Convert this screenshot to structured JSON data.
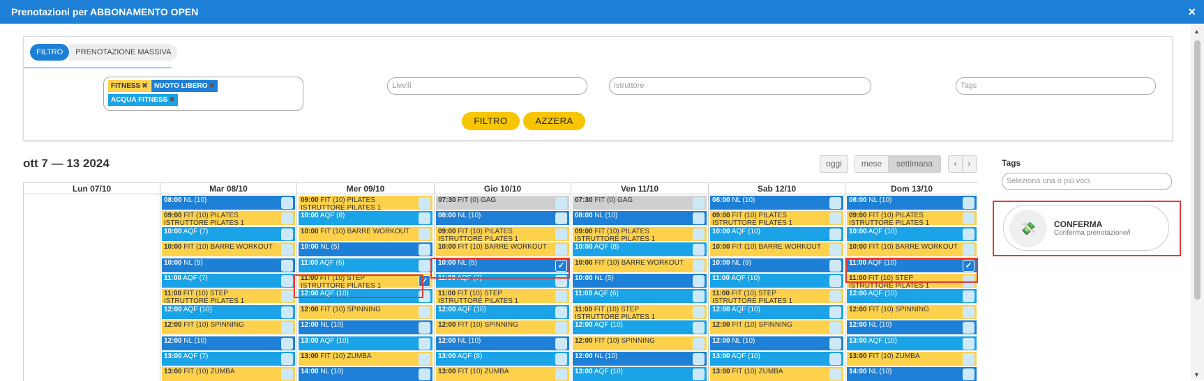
{
  "window": {
    "title": "Prenotazioni per ABBONAMENTO OPEN",
    "close": "×"
  },
  "filter": {
    "tab_active": "FILTRO",
    "tab_inactive": "PRENOTAZIONE MASSIVA",
    "chips": [
      "FITNESS",
      "NUOTO LIBERO",
      "ACQUA FITNESS"
    ],
    "livelli_placeholder": "Livelli",
    "istruttore_placeholder": "Istruttore",
    "tags_placeholder": "Tags",
    "btn_filtro": "FILTRO",
    "btn_azzera": "AZZERA"
  },
  "calendar": {
    "title": "ott 7 — 13 2024",
    "btn_oggi": "oggi",
    "btn_mese": "mese",
    "btn_settimana": "settimana",
    "btn_prev": "‹",
    "btn_next": "›",
    "days": [
      "Lun 07/10",
      "Mar 08/10",
      "Mer 09/10",
      "Gio 10/10",
      "Ven 11/10",
      "Sab 12/10",
      "Dom 13/10"
    ]
  },
  "events": [
    [],
    [
      {
        "t": "08:00",
        "txt": "NL (10)",
        "k": "nl"
      },
      {
        "t": "09:00",
        "txt": "FIT (10) PILATES",
        "sub": "ISTRUTTORE PILATES 1",
        "k": "fit"
      },
      {
        "t": "10:00",
        "txt": "AQF (7)",
        "k": "aqf"
      },
      {
        "t": "10:00",
        "txt": "FIT (10) BARRE WORKOUT",
        "k": "fit"
      },
      {
        "t": "10:00",
        "txt": "NL (5)",
        "k": "nl"
      },
      {
        "t": "11:00",
        "txt": "AQF (7)",
        "k": "aqf"
      },
      {
        "t": "11:00",
        "txt": "FIT (10) STEP",
        "sub": "ISTRUTTORE PILATES 1",
        "k": "fit"
      },
      {
        "t": "12:00",
        "txt": "AQF (10)",
        "k": "aqf"
      },
      {
        "t": "12:00",
        "txt": "FIT (10) SPINNING",
        "k": "fit"
      },
      {
        "t": "12:00",
        "txt": "NL (10)",
        "k": "nl"
      },
      {
        "t": "13:00",
        "txt": "AQF (7)",
        "k": "aqf"
      },
      {
        "t": "13:00",
        "txt": "FIT (10) ZUMBA",
        "k": "fit"
      }
    ],
    [
      {
        "t": "09:00",
        "txt": "FIT (10) PILATES",
        "sub": "ISTRUTTORE PILATES 1",
        "k": "fit"
      },
      {
        "t": "10:00",
        "txt": "AQF (8)",
        "k": "aqf"
      },
      {
        "t": "10:00",
        "txt": "FIT (10) BARRE WORKOUT",
        "k": "fit"
      },
      {
        "t": "10:00",
        "txt": "NL (5)",
        "k": "nl"
      },
      {
        "t": "11:00",
        "txt": "AQF (6)",
        "k": "aqf"
      },
      {
        "t": "11:00",
        "txt": "FIT (10) STEP",
        "sub": "ISTRUTTORE PILATES 1",
        "k": "fit",
        "checked": true
      },
      {
        "t": "12:00",
        "txt": "AQF (10)",
        "k": "aqf"
      },
      {
        "t": "12:00",
        "txt": "FIT (10) SPINNING",
        "k": "fit"
      },
      {
        "t": "12:00",
        "txt": "NL (10)",
        "k": "nl"
      },
      {
        "t": "13:00",
        "txt": "AQF (10)",
        "k": "aqf"
      },
      {
        "t": "13:00",
        "txt": "FIT (10) ZUMBA",
        "k": "fit"
      },
      {
        "t": "14:00",
        "txt": "NL (10)",
        "k": "nl"
      }
    ],
    [
      {
        "t": "07:30",
        "txt": "FIT (0) GAG",
        "k": "gag"
      },
      {
        "t": "08:00",
        "txt": "NL (10)",
        "k": "nl"
      },
      {
        "t": "09:00",
        "txt": "FIT (10) PILATES",
        "sub": "ISTRUTTORE PILATES 1",
        "k": "fit"
      },
      {
        "t": "10:00",
        "txt": "FIT (10) BARRE WORKOUT",
        "k": "fit"
      },
      {
        "t": "10:00",
        "txt": "NL (5)",
        "k": "nl",
        "checked": true
      },
      {
        "t": "11:00",
        "txt": "AQF (7)",
        "k": "aqf"
      },
      {
        "t": "11:00",
        "txt": "FIT (10) STEP",
        "sub": "ISTRUTTORE PILATES 1",
        "k": "fit"
      },
      {
        "t": "12:00",
        "txt": "AQF (10)",
        "k": "aqf"
      },
      {
        "t": "12:00",
        "txt": "FIT (10) SPINNING",
        "k": "fit"
      },
      {
        "t": "12:00",
        "txt": "NL (10)",
        "k": "nl"
      },
      {
        "t": "13:00",
        "txt": "AQF (8)",
        "k": "aqf"
      },
      {
        "t": "13:00",
        "txt": "FIT (10) ZUMBA",
        "k": "fit"
      }
    ],
    [
      {
        "t": "07:30",
        "txt": "FIT (0) GAG",
        "k": "gag"
      },
      {
        "t": "08:00",
        "txt": "NL (10)",
        "k": "nl"
      },
      {
        "t": "09:00",
        "txt": "FIT (10) PILATES",
        "sub": "ISTRUTTORE PILATES 1",
        "k": "fit"
      },
      {
        "t": "10:00",
        "txt": "AQF (8)",
        "k": "aqf"
      },
      {
        "t": "10:00",
        "txt": "FIT (10) BARRE WORKOUT",
        "k": "fit"
      },
      {
        "t": "10:00",
        "txt": "NL (5)",
        "k": "nl"
      },
      {
        "t": "11:00",
        "txt": "AQF (6)",
        "k": "aqf"
      },
      {
        "t": "11:00",
        "txt": "FIT (10) STEP",
        "sub": "ISTRUTTORE PILATES 1",
        "k": "fit"
      },
      {
        "t": "12:00",
        "txt": "AQF (10)",
        "k": "aqf"
      },
      {
        "t": "12:00",
        "txt": "FIT (10) SPINNING",
        "k": "fit"
      },
      {
        "t": "12:00",
        "txt": "NL (10)",
        "k": "nl"
      },
      {
        "t": "13:00",
        "txt": "AQF (10)",
        "k": "aqf"
      }
    ],
    [
      {
        "t": "08:00",
        "txt": "NL (10)",
        "k": "nl"
      },
      {
        "t": "09:00",
        "txt": "FIT (10) PILATES",
        "sub": "ISTRUTTORE PILATES 1",
        "k": "fit"
      },
      {
        "t": "10:00",
        "txt": "AQF (10)",
        "k": "aqf"
      },
      {
        "t": "10:00",
        "txt": "FIT (10) BARRE WORKOUT",
        "k": "fit"
      },
      {
        "t": "10:00",
        "txt": "NL (9)",
        "k": "nl"
      },
      {
        "t": "11:00",
        "txt": "AQF (10)",
        "k": "aqf"
      },
      {
        "t": "11:00",
        "txt": "FIT (10) STEP",
        "sub": "ISTRUTTORE PILATES 1",
        "k": "fit"
      },
      {
        "t": "12:00",
        "txt": "AQF (10)",
        "k": "aqf"
      },
      {
        "t": "12:00",
        "txt": "FIT (10) SPINNING",
        "k": "fit"
      },
      {
        "t": "12:00",
        "txt": "NL (10)",
        "k": "nl"
      },
      {
        "t": "13:00",
        "txt": "AQF (10)",
        "k": "aqf"
      },
      {
        "t": "13:00",
        "txt": "FIT (10) ZUMBA",
        "k": "fit"
      }
    ],
    [
      {
        "t": "08:00",
        "txt": "NL (10)",
        "k": "nl"
      },
      {
        "t": "09:00",
        "txt": "FIT (10) PILATES",
        "sub": "ISTRUTTORE PILATES 1",
        "k": "fit"
      },
      {
        "t": "10:00",
        "txt": "AQF (10)",
        "k": "aqf"
      },
      {
        "t": "10:00",
        "txt": "FIT (10) BARRE WORKOUT",
        "k": "fit"
      },
      {
        "t": "11:00",
        "txt": "AQF (10)",
        "k": "nl",
        "checked": true
      },
      {
        "t": "11:00",
        "txt": "FIT (10) STEP",
        "sub": "ISTRUTTORE PILATES 1",
        "k": "fit"
      },
      {
        "t": "12:00",
        "txt": "AQF (10)",
        "k": "aqf"
      },
      {
        "t": "12:00",
        "txt": "FIT (10) SPINNING",
        "k": "fit"
      },
      {
        "t": "12:00",
        "txt": "NL (10)",
        "k": "nl"
      },
      {
        "t": "13:00",
        "txt": "AQF (10)",
        "k": "aqf"
      },
      {
        "t": "13:00",
        "txt": "FIT (10) ZUMBA",
        "k": "fit"
      },
      {
        "t": "14:00",
        "txt": "NL (10)",
        "k": "nl"
      }
    ]
  ],
  "sidebar": {
    "tags_label": "Tags",
    "tags_placeholder": "Seleziona una o più voci",
    "confirm_title": "CONFERMA",
    "confirm_sub": "Conferma prenotazione/i",
    "confirm_icon": "money-icon"
  },
  "colors": {
    "primary": "#1e7fd6",
    "fit": "#fed14d",
    "aqf": "#1aa3e6",
    "highlight": "#e53935",
    "button": "#f7c600"
  }
}
